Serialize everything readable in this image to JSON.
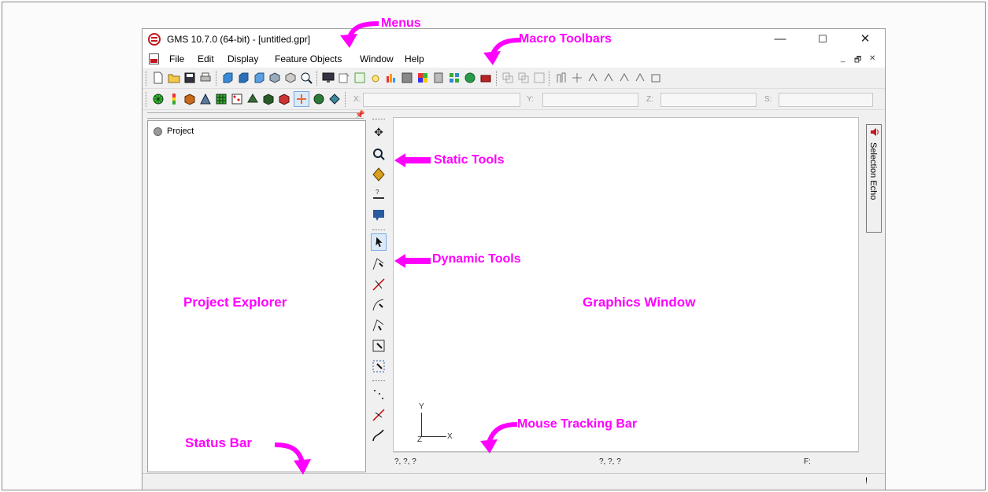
{
  "window": {
    "title": "GMS 10.7.0 (64-bit) - [untitled.gpr]",
    "controls": {
      "minimize": "—",
      "maximize": "☐",
      "close": "✕"
    }
  },
  "menubar": {
    "items": [
      "File",
      "Edit",
      "Display",
      "Feature Objects",
      "Window",
      "Help"
    ],
    "mdi": {
      "minimize": "_",
      "restore": "🗗",
      "close": "✕"
    }
  },
  "mouse_tracking": {
    "x_label": "X:",
    "y_label": "Y:",
    "z_label": "Z:",
    "s_label": "S:"
  },
  "project_explorer": {
    "root": "Project"
  },
  "track_bar": {
    "left": "?, ?, ?",
    "middle": "?, ?, ?",
    "right": "F:"
  },
  "axes": {
    "y": "Y",
    "z": "Z",
    "x": "X"
  },
  "selection_echo": {
    "label": "Selection Echo"
  },
  "status_bar": {
    "indicator": "!"
  },
  "annotations": {
    "menus": "Menus",
    "macro_toolbars": "Macro Toolbars",
    "static_tools": "Static Tools",
    "dynamic_tools": "Dynamic Tools",
    "project_explorer": "Project Explorer",
    "graphics_window": "Graphics Window",
    "mouse_tracking_bar": "Mouse Tracking Bar",
    "status_bar": "Status Bar"
  },
  "colors": {
    "annotation": "#ff00ff",
    "brand": "#c4161c"
  }
}
